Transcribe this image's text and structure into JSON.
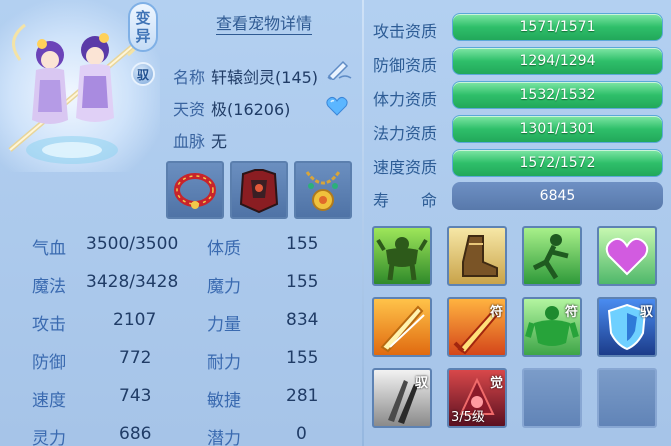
{
  "pet": {
    "badge_top": "变",
    "badge_bottom": "异",
    "yu_badge": "驭"
  },
  "header": {
    "detail_link": "查看宠物详情"
  },
  "info": {
    "name_label": "名称",
    "name_value": "轩辕剑灵(145)",
    "talent_label": "天资",
    "talent_value": "极(16206)",
    "blood_label": "血脉",
    "blood_value": "无"
  },
  "equipment": [
    {
      "name": "collar"
    },
    {
      "name": "armor"
    },
    {
      "name": "amulet"
    }
  ],
  "stats_left": [
    {
      "label": "气血",
      "value": "3500/3500"
    },
    {
      "label": "魔法",
      "value": "3428/3428"
    },
    {
      "label": "攻击",
      "value": "2107"
    },
    {
      "label": "防御",
      "value": "772"
    },
    {
      "label": "速度",
      "value": "743"
    },
    {
      "label": "灵力",
      "value": "686"
    }
  ],
  "stats_right": [
    {
      "label": "体质",
      "value": "155"
    },
    {
      "label": "魔力",
      "value": "155"
    },
    {
      "label": "力量",
      "value": "834"
    },
    {
      "label": "耐力",
      "value": "155"
    },
    {
      "label": "敏捷",
      "value": "281"
    },
    {
      "label": "潜力",
      "value": "0"
    }
  ],
  "aptitudes": [
    {
      "label": "攻击资质",
      "value": "1571/1571"
    },
    {
      "label": "防御资质",
      "value": "1294/1294"
    },
    {
      "label": "体力资质",
      "value": "1532/1532"
    },
    {
      "label": "法力资质",
      "value": "1301/1301"
    },
    {
      "label": "速度资质",
      "value": "1572/1572"
    }
  ],
  "life": {
    "label": "寿　　命",
    "value": "6845"
  },
  "skills": {
    "row3_tag1": "驭",
    "row2_tag_fu1": "符",
    "row2_tag_fu2": "符",
    "row2_tag_yu": "驭",
    "row3_tag_jue": "觉",
    "row3_level": "3/5级"
  },
  "colors": {
    "accent": "#2fbf6a",
    "panel": "#a9c7ea",
    "text": "#2d5c95"
  }
}
